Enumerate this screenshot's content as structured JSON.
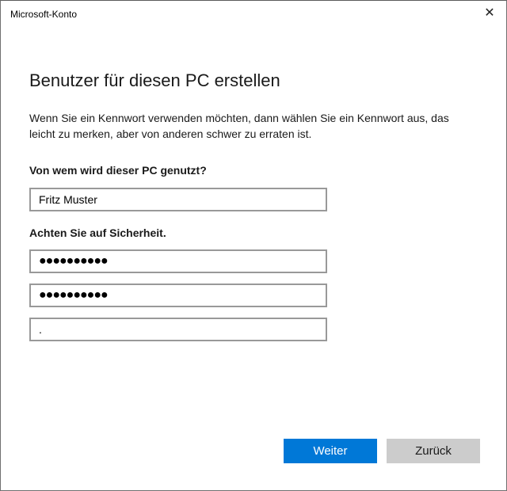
{
  "window": {
    "title": "Microsoft-Konto",
    "close_icon": "✕"
  },
  "heading": "Benutzer für diesen PC erstellen",
  "description": "Wenn Sie ein Kennwort verwenden möchten, dann wählen Sie ein Kennwort aus, das leicht zu merken, aber von anderen schwer zu erraten ist.",
  "user_label": "Von wem wird dieser PC genutzt?",
  "username_value": "Fritz Muster",
  "security_label": "Achten Sie auf Sicherheit.",
  "password_value": "●●●●●●●●●●",
  "password_confirm_value": "●●●●●●●●●●",
  "hint_value": ".",
  "buttons": {
    "next": "Weiter",
    "back": "Zurück"
  },
  "colors": {
    "accent": "#0078d7",
    "secondary": "#cccccc"
  }
}
